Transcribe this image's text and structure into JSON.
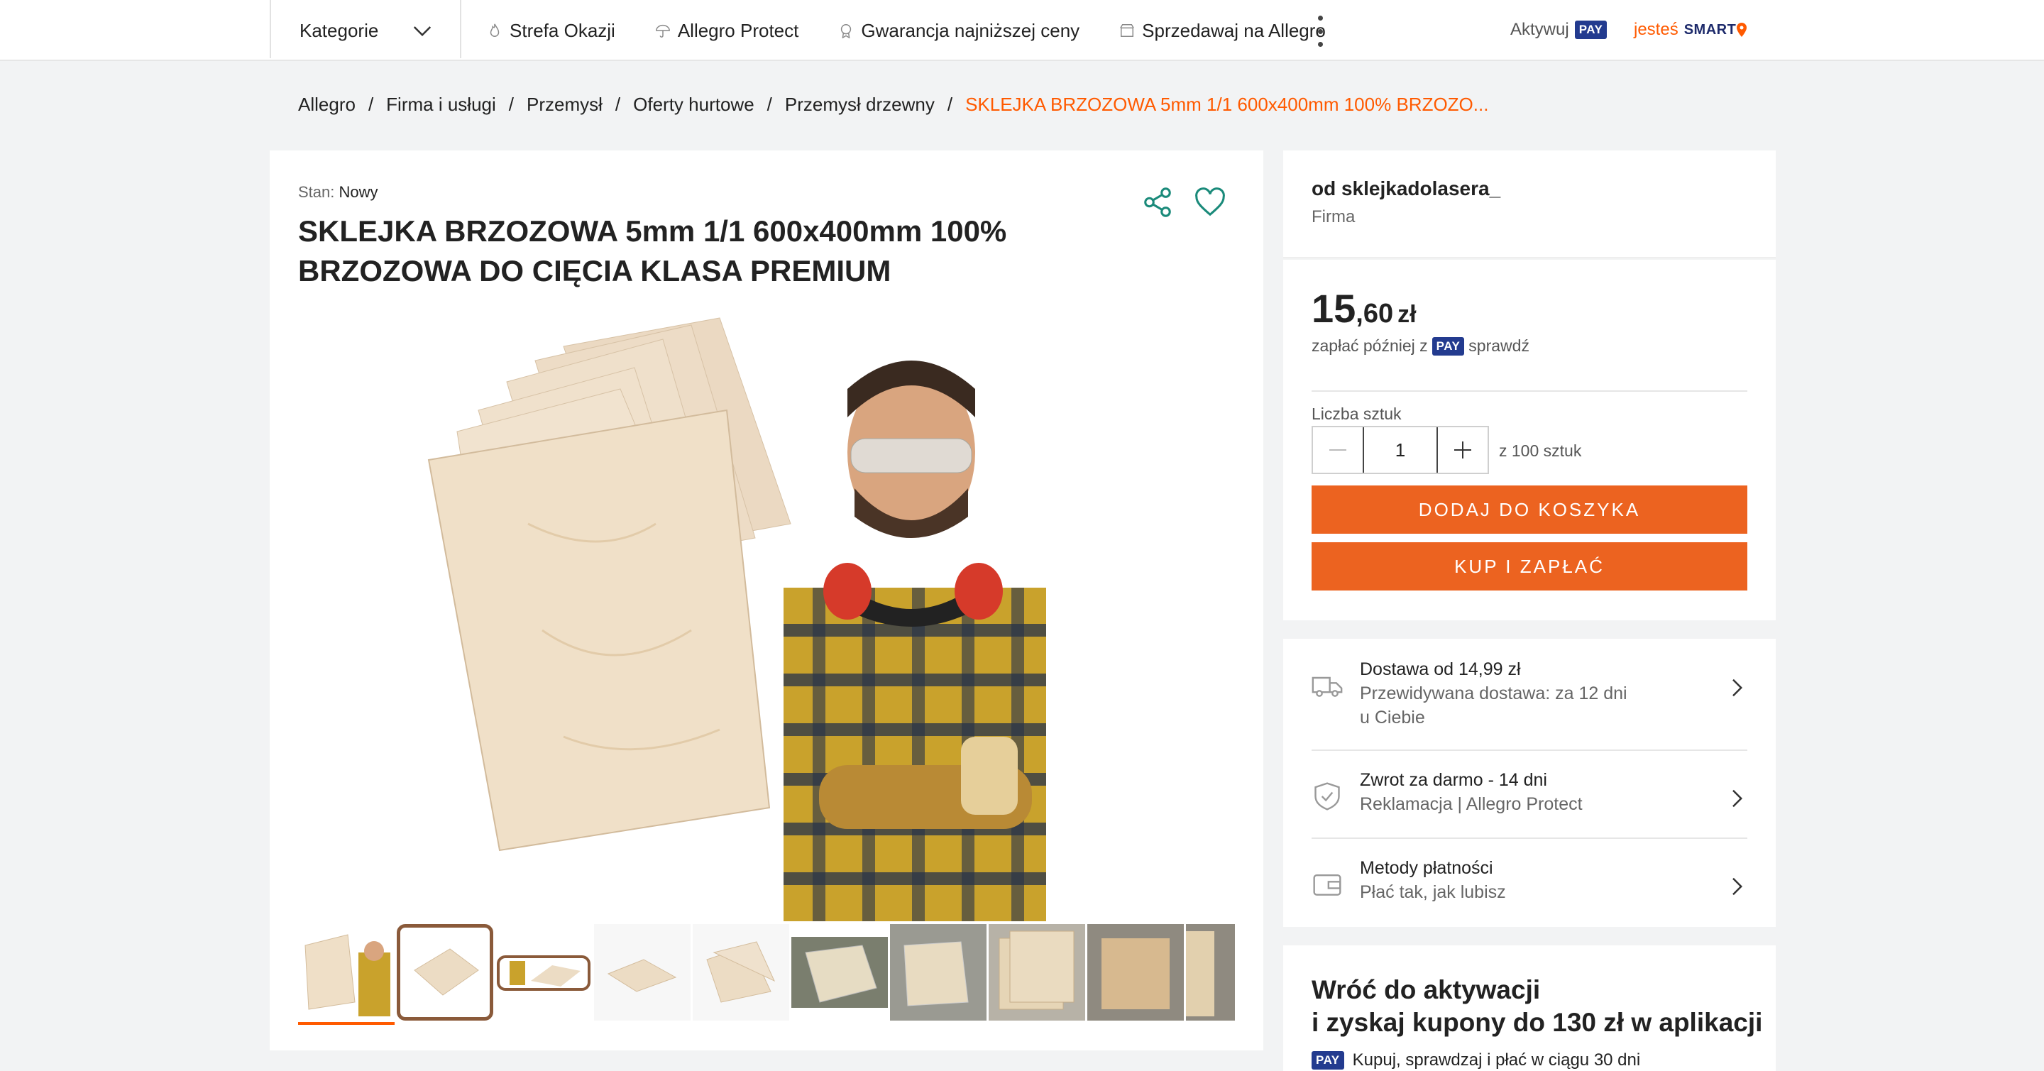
{
  "topbar": {
    "categories_label": "Kategorie",
    "nav": [
      {
        "label": "Strefa Okazji",
        "icon": "flame-icon"
      },
      {
        "label": "Allegro Protect",
        "icon": "umbrella-icon"
      },
      {
        "label": "Gwarancja najniższej ceny",
        "icon": "badge-icon"
      },
      {
        "label": "Sprzedawaj na Allegro",
        "icon": "shop-icon"
      }
    ],
    "aktywuj_label": "Aktywuj",
    "pay_label": "PAY",
    "smart_prefix": "jesteś",
    "smart_label": "SMART"
  },
  "breadcrumb": [
    "Allegro",
    "Firma i usługi",
    "Przemysł",
    "Oferty hurtowe",
    "Przemysł drzewny",
    "SKLEJKA BRZOZOWA 5mm 1/1 600x400mm 100% BRZOZO..."
  ],
  "product": {
    "condition_label": "Stan:",
    "condition_value": "Nowy",
    "title": "SKLEJKA BRZOZOWA 5mm 1/1 600x400mm 100% BRZOZOWA DO CIĘCIA KLASA PREMIUM",
    "thumbnail_count": 10,
    "selected_thumbnail": 1
  },
  "seller": {
    "name": "od sklejkadolasera_",
    "type": "Firma"
  },
  "buybox": {
    "price_int": "15",
    "price_dec": ",60",
    "currency": "zł",
    "paylater_text": "zapłać później z",
    "pay_label": "PAY",
    "check_label": "sprawdź",
    "quantity_label": "Liczba sztuk",
    "quantity_value": "1",
    "stock_text": "z 100 sztuk",
    "add_to_cart": "DODAJ DO KOSZYKA",
    "buy_now": "KUP I ZAPŁAĆ"
  },
  "info_rows": [
    {
      "line1": "Dostawa od 14,99 zł",
      "line2": "Przewidywana dostawa: za 12 dni",
      "line3": "u Ciebie",
      "icon": "truck-icon"
    },
    {
      "line1": "Zwrot za darmo - 14 dni",
      "line2": "Reklamacja | Allegro Protect",
      "icon": "shield-check-icon"
    },
    {
      "line1": "Metody płatności",
      "line2": "Płać tak, jak lubisz",
      "icon": "wallet-icon"
    }
  ],
  "promo": {
    "heading_line1": "Wróć do aktywacji",
    "heading_line2": "i zyskaj kupony do 130 zł w aplikacji",
    "pay_label": "PAY",
    "sub": "Kupuj, sprawdzaj i płać w ciągu 30 dni"
  },
  "colors": {
    "accent": "#ff5a00",
    "button": "#ec6320",
    "pay_badge": "#233b8f",
    "teal_icons": "#1a8a7a"
  }
}
